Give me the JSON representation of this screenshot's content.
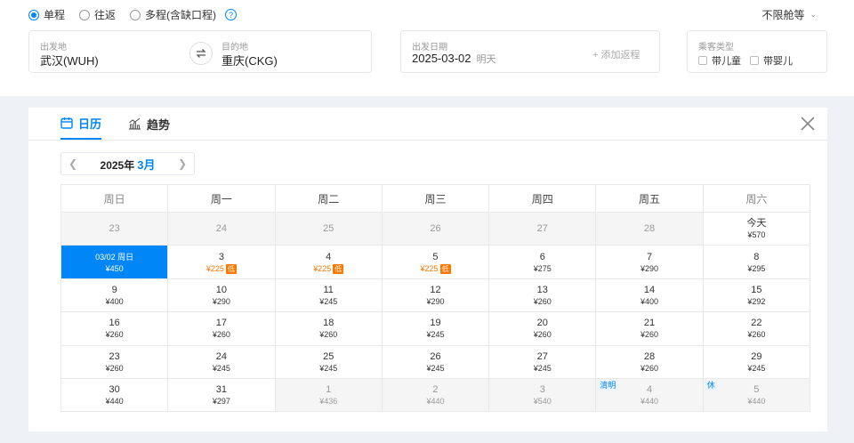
{
  "trip_types": [
    {
      "label": "单程",
      "checked": true
    },
    {
      "label": "往返",
      "checked": false
    },
    {
      "label": "多程(含缺口程)",
      "checked": false
    }
  ],
  "help_glyph": "?",
  "cabin": {
    "label": "不限舱等"
  },
  "departure": {
    "label": "出发地",
    "value": "武汉(WUH)"
  },
  "arrival": {
    "label": "目的地",
    "value": "重庆(CKG)"
  },
  "date": {
    "label": "出发日期",
    "value": "2025-03-02",
    "sub": "明天",
    "add_return": "+ 添加返程"
  },
  "passenger": {
    "label": "乘客类型",
    "options": [
      "带儿童",
      "带婴儿"
    ]
  },
  "tabs": [
    {
      "label": "日历",
      "icon": "calendar-icon",
      "active": true
    },
    {
      "label": "趋势",
      "icon": "trend-chart-icon",
      "active": false
    }
  ],
  "month": {
    "year": "2025年",
    "month": "3月"
  },
  "weekdays": [
    "周日",
    "周一",
    "周二",
    "周三",
    "周四",
    "周五",
    "周六"
  ],
  "low_badge": "低",
  "colors": {
    "accent": "#0086f6",
    "low_price": "#ff7700"
  },
  "calendar": [
    [
      {
        "day": "23",
        "price": "",
        "state": "prev"
      },
      {
        "day": "24",
        "price": "",
        "state": "prev"
      },
      {
        "day": "25",
        "price": "",
        "state": "prev"
      },
      {
        "day": "26",
        "price": "",
        "state": "prev"
      },
      {
        "day": "27",
        "price": "",
        "state": "prev"
      },
      {
        "day": "28",
        "price": "",
        "state": "prev"
      },
      {
        "day": "今天",
        "price": "¥570",
        "state": "normal"
      }
    ],
    [
      {
        "day": "03/02 周日",
        "price": "¥450",
        "state": "selected"
      },
      {
        "day": "3",
        "price": "¥225",
        "state": "low"
      },
      {
        "day": "4",
        "price": "¥225",
        "state": "low"
      },
      {
        "day": "5",
        "price": "¥225",
        "state": "low"
      },
      {
        "day": "6",
        "price": "¥275",
        "state": "normal"
      },
      {
        "day": "7",
        "price": "¥290",
        "state": "normal"
      },
      {
        "day": "8",
        "price": "¥295",
        "state": "normal"
      }
    ],
    [
      {
        "day": "9",
        "price": "¥400",
        "state": "normal"
      },
      {
        "day": "10",
        "price": "¥290",
        "state": "normal"
      },
      {
        "day": "11",
        "price": "¥245",
        "state": "normal"
      },
      {
        "day": "12",
        "price": "¥290",
        "state": "normal"
      },
      {
        "day": "13",
        "price": "¥260",
        "state": "normal"
      },
      {
        "day": "14",
        "price": "¥400",
        "state": "normal"
      },
      {
        "day": "15",
        "price": "¥292",
        "state": "normal"
      }
    ],
    [
      {
        "day": "16",
        "price": "¥260",
        "state": "normal"
      },
      {
        "day": "17",
        "price": "¥260",
        "state": "normal"
      },
      {
        "day": "18",
        "price": "¥260",
        "state": "normal"
      },
      {
        "day": "19",
        "price": "¥245",
        "state": "normal"
      },
      {
        "day": "20",
        "price": "¥260",
        "state": "normal"
      },
      {
        "day": "21",
        "price": "¥260",
        "state": "normal"
      },
      {
        "day": "22",
        "price": "¥260",
        "state": "normal"
      }
    ],
    [
      {
        "day": "23",
        "price": "¥260",
        "state": "normal"
      },
      {
        "day": "24",
        "price": "¥245",
        "state": "normal"
      },
      {
        "day": "25",
        "price": "¥245",
        "state": "normal"
      },
      {
        "day": "26",
        "price": "¥245",
        "state": "normal"
      },
      {
        "day": "27",
        "price": "¥245",
        "state": "normal"
      },
      {
        "day": "28",
        "price": "¥260",
        "state": "normal"
      },
      {
        "day": "29",
        "price": "¥245",
        "state": "normal"
      }
    ],
    [
      {
        "day": "30",
        "price": "¥440",
        "state": "normal"
      },
      {
        "day": "31",
        "price": "¥297",
        "state": "normal"
      },
      {
        "day": "1",
        "price": "¥436",
        "state": "outside"
      },
      {
        "day": "2",
        "price": "¥440",
        "state": "outside"
      },
      {
        "day": "3",
        "price": "¥540",
        "state": "outside"
      },
      {
        "day": "4",
        "price": "¥440",
        "state": "outside",
        "holiday": "清明"
      },
      {
        "day": "5",
        "price": "¥440",
        "state": "outside",
        "holiday": "休"
      }
    ]
  ]
}
